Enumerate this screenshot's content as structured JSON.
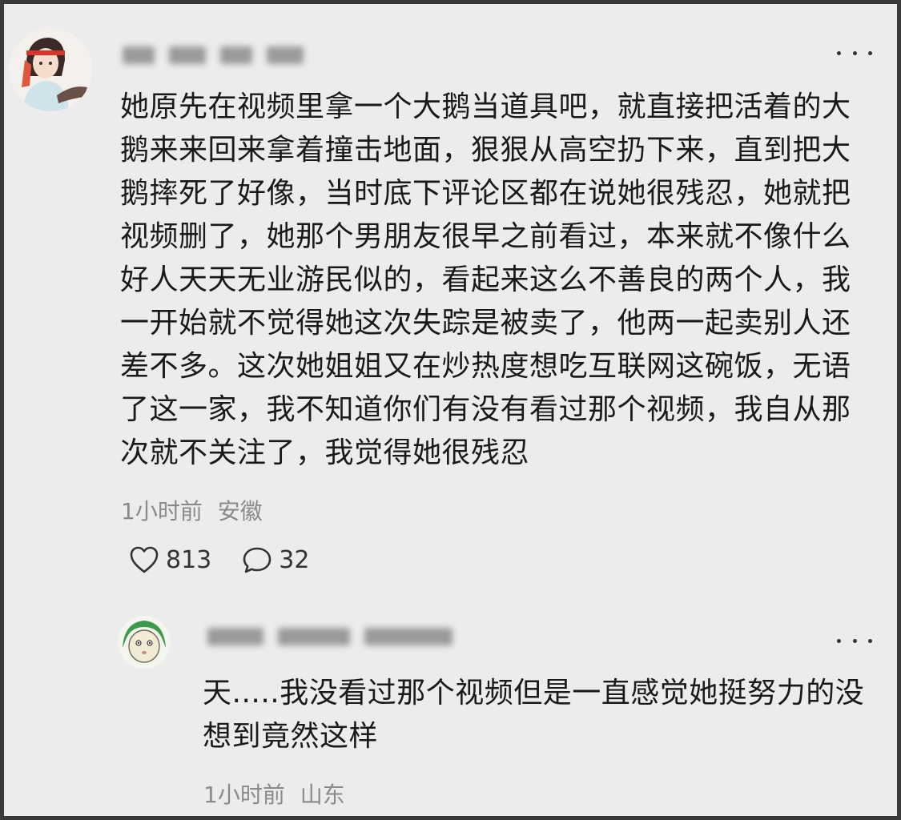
{
  "comments": [
    {
      "text": "她原先在视频里拿一个大鹅当道具吧，就直接把活着的大鹅来来回来拿着撞击地面，狠狠从高空扔下来，直到把大鹅摔死了好像，当时底下评论区都在说她很残忍，她就把视频删了，她那个男朋友很早之前看过，本来就不像什么好人天天无业游民似的，看起来这么不善良的两个人，我一开始就不觉得她这次失踪是被卖了，他两一起卖别人还差不多。这次她姐姐又在炒热度想吃互联网这碗饭，无语了这一家，我不知道你们有没有看过那个视频，我自从那次就不关注了，我觉得她很残忍",
      "time": "1小时前",
      "location": "安徽",
      "likes": "813",
      "replies": "32"
    },
    {
      "text": "天.....我没看过那个视频但是一直感觉她挺努力的没想到竟然这样",
      "time": "1小时前",
      "location": "山东"
    }
  ],
  "icons": {
    "more": "more-horizontal-icon",
    "like": "heart-outline-icon",
    "reply": "speech-bubble-icon"
  },
  "colors": {
    "background": "#ececec",
    "text": "#1a1a1a",
    "meta": "#8a8a8a",
    "border": "#3a3a3a"
  }
}
